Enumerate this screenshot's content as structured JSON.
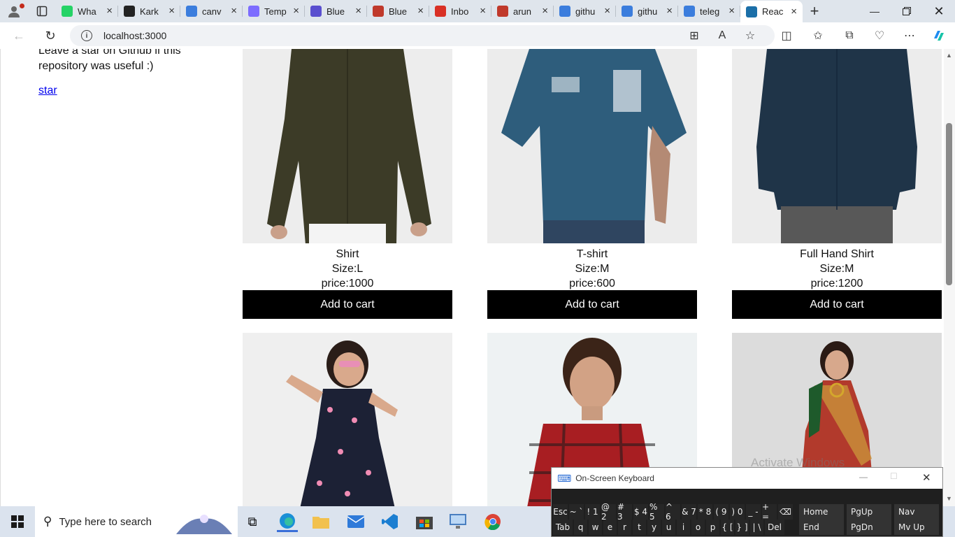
{
  "browser": {
    "tabs": [
      {
        "label": "Wha",
        "icon": "whatsapp-icon",
        "color": "#25d366"
      },
      {
        "label": "Kark",
        "icon": "github-icon",
        "color": "#222222"
      },
      {
        "label": "canv",
        "icon": "search-icon",
        "color": "#3b7ddd"
      },
      {
        "label": "Temp",
        "icon": "template-icon",
        "color": "#7c6cff"
      },
      {
        "label": "Blue",
        "icon": "app-icon",
        "color": "#5a4fcf"
      },
      {
        "label": "Blue",
        "icon": "pdf-icon",
        "color": "#c0392b"
      },
      {
        "label": "Inbo",
        "icon": "gmail-icon",
        "color": "#d93025"
      },
      {
        "label": "arun",
        "icon": "pdf-icon",
        "color": "#c0392b"
      },
      {
        "label": "githu",
        "icon": "search-icon",
        "color": "#3b7ddd"
      },
      {
        "label": "githu",
        "icon": "search-icon",
        "color": "#3b7ddd"
      },
      {
        "label": "teleg",
        "icon": "search-icon",
        "color": "#3b7ddd"
      },
      {
        "label": "Reac",
        "icon": "react-icon",
        "color": "#1b6fa8",
        "active": true
      }
    ],
    "url": "localhost:3000"
  },
  "page": {
    "note": "Leave a star on Github if this repository was useful :)",
    "star_link": "star",
    "products": [
      {
        "name": "Shirt",
        "size": "Size:L",
        "price": "price:1000",
        "button": "Add to cart",
        "image": "dark-olive-shirt"
      },
      {
        "name": "T-shirt",
        "size": "Size:M",
        "price": "price:600",
        "button": "Add to cart",
        "image": "blue-polo-tshirt"
      },
      {
        "name": "Full Hand Shirt",
        "size": "Size:M",
        "price": "price:1200",
        "button": "Add to cart",
        "image": "navy-full-hand-shirt"
      },
      {
        "name": "",
        "image": "girl-heart-print-dress"
      },
      {
        "name": "",
        "image": "boy-red-check-shirt"
      },
      {
        "name": "",
        "image": "woman-red-saree"
      }
    ]
  },
  "watermark": "Activate Windows",
  "taskbar": {
    "search_placeholder": "Type here to search"
  },
  "osk": {
    "title": "On-Screen Keyboard",
    "row1": [
      "Esc",
      "~ `",
      "! 1",
      "@ 2",
      "# 3",
      "$ 4",
      "% 5",
      "^ 6",
      "& 7",
      "* 8",
      "( 9",
      ") 0",
      "_ -",
      "+ =",
      "⌫"
    ],
    "row2": [
      "Tab",
      "q",
      "w",
      "e",
      "r",
      "t",
      "y",
      "u",
      "i",
      "o",
      "p",
      "{ [",
      "} ]",
      "| \\",
      "Del"
    ],
    "nav1": [
      "Home",
      "PgUp",
      "Nav"
    ],
    "nav2": [
      "End",
      "PgDn",
      "Mv Up"
    ]
  }
}
